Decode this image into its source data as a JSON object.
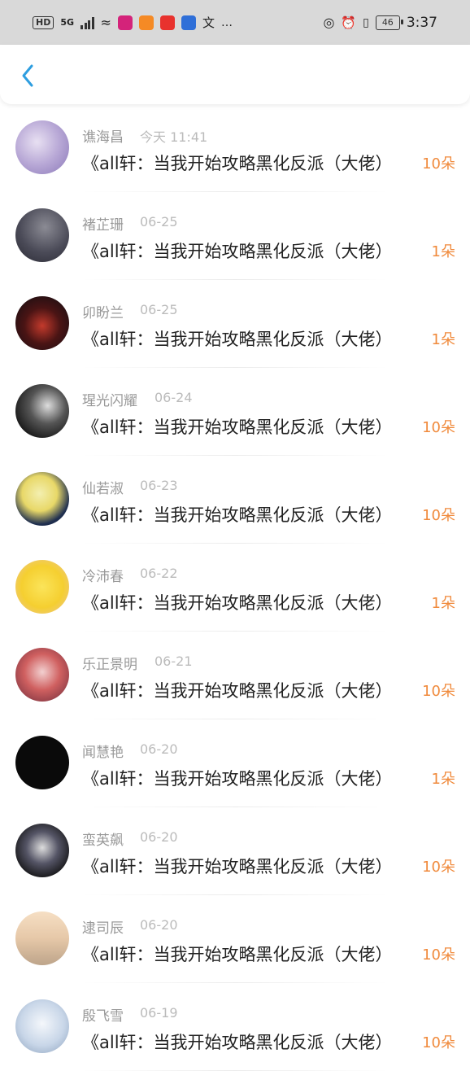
{
  "status_bar": {
    "hd_label": "HD",
    "network_label": "5G",
    "battery_level": "46",
    "time": "3:37",
    "dots": "…"
  },
  "header": {
    "back_icon": "chevron-left-icon",
    "accent_color": "#2e9ee0"
  },
  "items": [
    {
      "name": "谯海昌",
      "date": "今天 11:41",
      "title": "《all轩：当我开始攻略黑化反派（大佬）",
      "count": "10朵"
    },
    {
      "name": "褚芷珊",
      "date": "06-25",
      "title": "《all轩：当我开始攻略黑化反派（大佬）",
      "count": "1朵"
    },
    {
      "name": "卯盼兰",
      "date": "06-25",
      "title": "《all轩：当我开始攻略黑化反派（大佬）",
      "count": "1朵"
    },
    {
      "name": "瑆光闪耀",
      "date": "06-24",
      "title": "《all轩：当我开始攻略黑化反派（大佬）",
      "count": "10朵"
    },
    {
      "name": "仙若淑",
      "date": "06-23",
      "title": "《all轩：当我开始攻略黑化反派（大佬）",
      "count": "10朵"
    },
    {
      "name": "冷沛春",
      "date": "06-22",
      "title": "《all轩：当我开始攻略黑化反派（大佬）",
      "count": "1朵"
    },
    {
      "name": "乐正景明",
      "date": "06-21",
      "title": "《all轩：当我开始攻略黑化反派（大佬）",
      "count": "10朵"
    },
    {
      "name": "闻慧艳",
      "date": "06-20",
      "title": "《all轩：当我开始攻略黑化反派（大佬）",
      "count": "1朵"
    },
    {
      "name": "蛮英飙",
      "date": "06-20",
      "title": "《all轩：当我开始攻略黑化反派（大佬）",
      "count": "10朵"
    },
    {
      "name": "逮司辰",
      "date": "06-20",
      "title": "《all轩：当我开始攻略黑化反派（大佬）",
      "count": "10朵"
    },
    {
      "name": "殷飞雪",
      "date": "06-19",
      "title": "《all轩：当我开始攻略黑化反派（大佬）",
      "count": "10朵"
    }
  ],
  "colors": {
    "count": "#f08a3c",
    "name": "#999999",
    "date": "#bbbbbb",
    "title": "#222222"
  }
}
